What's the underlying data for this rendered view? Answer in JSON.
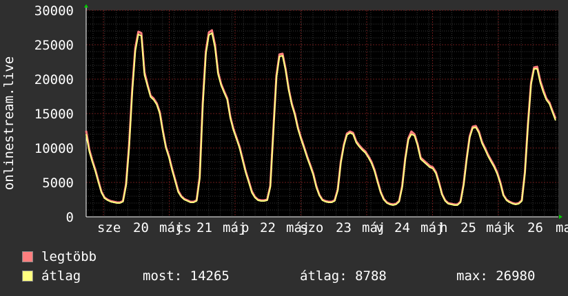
{
  "chart_data": {
    "type": "line",
    "ylabel": "onlinestream.live",
    "ylim": [
      0,
      30000
    ],
    "y_ticks": [
      "0",
      "5000",
      "10000",
      "15000",
      "20000",
      "25000",
      "30000"
    ],
    "x_tick_labels": [
      "sze",
      "20",
      "máj",
      "cs",
      "21",
      "máj",
      "p",
      "22",
      "máj",
      "szo",
      "23",
      "máj",
      "v",
      "24",
      "máj",
      "h",
      "25",
      "máj",
      "k",
      "26",
      "ma"
    ],
    "grid": true,
    "series": [
      {
        "name": "legtöbb",
        "color": "#ff7f7f",
        "values": [
          12500,
          9800,
          8200,
          6800,
          5200,
          3600,
          2800,
          2500,
          2300,
          2200,
          2100,
          2100,
          2300,
          4800,
          10500,
          18500,
          24500,
          26900,
          26700,
          21000,
          19200,
          17600,
          17200,
          16500,
          15200,
          12500,
          10200,
          8800,
          7000,
          5400,
          3800,
          3000,
          2600,
          2400,
          2200,
          2200,
          2400,
          5800,
          16500,
          24000,
          26800,
          27100,
          25000,
          21000,
          19300,
          18200,
          17200,
          14500,
          12800,
          11500,
          10200,
          8400,
          6600,
          5200,
          3700,
          2900,
          2500,
          2400,
          2400,
          2500,
          4500,
          12500,
          20500,
          23600,
          23700,
          21500,
          18600,
          16500,
          15000,
          13000,
          11500,
          10200,
          8800,
          7600,
          6300,
          4500,
          3200,
          2500,
          2300,
          2200,
          2200,
          2400,
          4000,
          8000,
          10500,
          12100,
          12400,
          12200,
          11000,
          10400,
          9900,
          9500,
          8800,
          8000,
          6800,
          5200,
          3600,
          2600,
          2100,
          1900,
          1800,
          1900,
          2300,
          4500,
          8500,
          11400,
          12400,
          12000,
          10600,
          8600,
          8200,
          7800,
          7400,
          7200,
          6500,
          5000,
          3300,
          2400,
          2000,
          1900,
          1800,
          1800,
          2200,
          4700,
          8400,
          11700,
          13100,
          13200,
          12400,
          10900,
          10000,
          9000,
          8200,
          7400,
          6400,
          5000,
          3200,
          2500,
          2200,
          2000,
          1900,
          2000,
          2400,
          6500,
          13500,
          19500,
          21700,
          21800,
          19800,
          18400,
          17200,
          16600,
          15400,
          14265
        ]
      },
      {
        "name": "átlag",
        "color": "#ffff80",
        "values": [
          12000,
          9500,
          8000,
          6600,
          5000,
          3500,
          2700,
          2400,
          2200,
          2100,
          2000,
          2000,
          2200,
          4500,
          10000,
          18000,
          24000,
          26500,
          26300,
          20600,
          19000,
          17400,
          17000,
          16300,
          15000,
          12300,
          10000,
          8600,
          6800,
          5200,
          3600,
          2900,
          2500,
          2300,
          2100,
          2100,
          2300,
          5500,
          16000,
          23600,
          26400,
          26700,
          24600,
          20700,
          19100,
          18000,
          17000,
          14300,
          12600,
          11300,
          10000,
          8200,
          6400,
          5000,
          3500,
          2800,
          2400,
          2300,
          2300,
          2400,
          4300,
          12200,
          20200,
          23300,
          23400,
          21300,
          18400,
          16300,
          14800,
          12800,
          11300,
          10000,
          8600,
          7400,
          6100,
          4300,
          3100,
          2400,
          2200,
          2100,
          2100,
          2300,
          3800,
          7800,
          10300,
          11900,
          12200,
          12000,
          10800,
          10200,
          9700,
          9300,
          8600,
          7800,
          6600,
          5000,
          3500,
          2500,
          2000,
          1800,
          1700,
          1800,
          2200,
          4300,
          8300,
          11200,
          12000,
          11800,
          10400,
          8400,
          8000,
          7600,
          7200,
          7000,
          6300,
          4800,
          3200,
          2300,
          1900,
          1800,
          1700,
          1700,
          2100,
          4500,
          8200,
          11500,
          12900,
          13000,
          12200,
          10700,
          9800,
          8800,
          8000,
          7200,
          6200,
          4800,
          3100,
          2400,
          2100,
          1900,
          1800,
          1900,
          2300,
          6300,
          13200,
          19200,
          21500,
          21500,
          19500,
          18100,
          17000,
          16400,
          15200,
          14000
        ]
      }
    ],
    "summary": {
      "now": 14265,
      "avg": 8788,
      "max": 26980
    }
  },
  "legend": [
    {
      "label": "legtöbb",
      "color": "#ff7f7f"
    },
    {
      "label": "átlag",
      "color": "#ffff80"
    }
  ],
  "stats": {
    "now": "most: 14265",
    "avg": "átlag: 8788",
    "max": "max: 26980"
  },
  "colors": {
    "background": "#2f2f2f",
    "plot_background": "#000000",
    "grid_major": "#6b1a1a",
    "grid_minor": "#3a3a3a",
    "axis_arrow": "#00cc00"
  }
}
